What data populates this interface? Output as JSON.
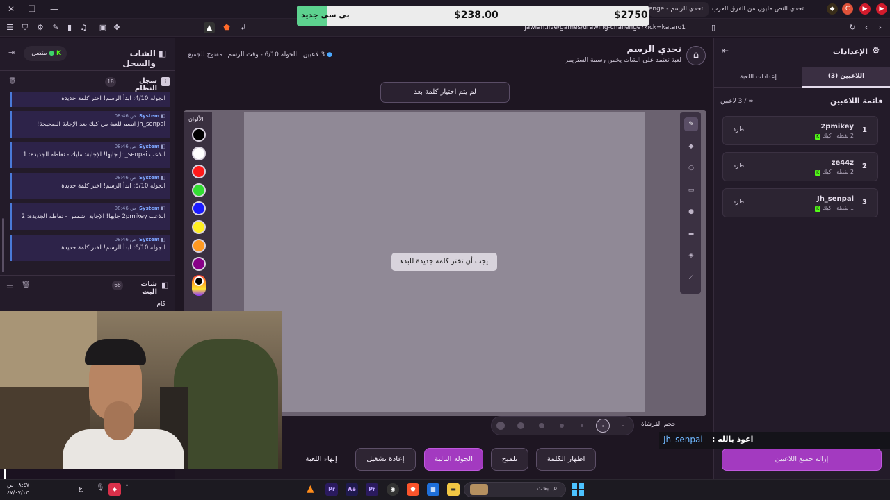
{
  "browser": {
    "tabs": [
      {
        "label": "تحدي الرسم - Challenge"
      },
      {
        "label": "تحدي النص مليون من الفرق للعرب بالك..."
      }
    ],
    "url": "jawlah.live/games/drawing-challenge?kick=kataro1"
  },
  "price_overlay": {
    "left_label": "بي سي جديد",
    "mid_price": "$238.00",
    "right_price": "$2750"
  },
  "left_panel": {
    "title": "الشات والسجل",
    "status": "متصل",
    "system_log": {
      "title": "سجل النظام",
      "count": "18",
      "messages": [
        {
          "sender": "",
          "time": "",
          "text": "الجوله 4/10: ابدأ الرسم! اختر كلمة جديدة"
        },
        {
          "sender": "System",
          "time": "08:46 ص",
          "text": "Jh_senpai انضم للعبة من كيك بعد الإجابة الصحيحة!"
        },
        {
          "sender": "System",
          "time": "08:46 ص",
          "text": "اللاعب Jh_senpai جابها! الإجابة: مايك - نقاطه الجديدة: 1"
        },
        {
          "sender": "System",
          "time": "08:46 ص",
          "text": "الجوله 5/10: ابدأ الرسم! اختر كلمة جديدة"
        },
        {
          "sender": "System",
          "time": "08:46 ص",
          "text": "اللاعب 2pmikey جابها! الإجابة: شمس - نقاطه الجديدة: 2"
        },
        {
          "sender": "System",
          "time": "08:46 ص",
          "text": "الجوله 6/10: ابدأ الرسم! اختر كلمة جديدة"
        }
      ]
    },
    "stream_chat": {
      "title": "شات البث",
      "count": "68",
      "last_message": "كام"
    }
  },
  "game": {
    "title": "تحدي الرسم",
    "subtitle": "لعبة تعتمد على الشات يخمن رسمة الستريمر",
    "players_count": "3 لاعبين",
    "round_info": "الجوله 6/10 - وقت الرسم",
    "open_label": "مفتوح للجميع",
    "word_status": "لم يتم اختيار كلمة بعد",
    "canvas_notice": "يجب أن تختر كلمة جديدة للبدء",
    "colors_label": "الألوان",
    "colors": [
      "#000000",
      "#ffffff",
      "#ff1a1a",
      "#33dd33",
      "#1a1aff",
      "#ffee22",
      "#ff9922",
      "#880088"
    ],
    "brush_label": "حجم الفرشاة:",
    "buttons": {
      "reveal": "اظهار الكلمة",
      "hint": "تلميح",
      "next_round": "الجوله التالية",
      "restart": "إعادة تشغيل",
      "end": "إنهاء اللعبة"
    }
  },
  "right_panel": {
    "title": "الإعدادات",
    "tabs": {
      "players": "اللاعبين (3)",
      "settings": "إعدادات اللعبة"
    },
    "list_title": "قائمة اللاعبين",
    "list_count": "∞ / 3 لاعبين",
    "kick_label": "طرد",
    "players": [
      {
        "rank": "1",
        "name": "2pmikey",
        "source": "كيك",
        "points": "2 نقطة"
      },
      {
        "rank": "2",
        "name": "ze44z",
        "source": "كيك",
        "points": "2 نقطة"
      },
      {
        "rank": "3",
        "name": "Jh_senpai",
        "source": "كيك",
        "points": "1 نقطة"
      }
    ],
    "remove_all": "إزالة جميع اللاعبين"
  },
  "chat_overlay": {
    "user": "Jh_senpai",
    "message": "اعوذ بالله :"
  },
  "taskbar": {
    "search_placeholder": "بحث",
    "time": "٠٨:٤٧ ص",
    "date": "٤٧/٠٧/١٣",
    "lang": "ع"
  }
}
